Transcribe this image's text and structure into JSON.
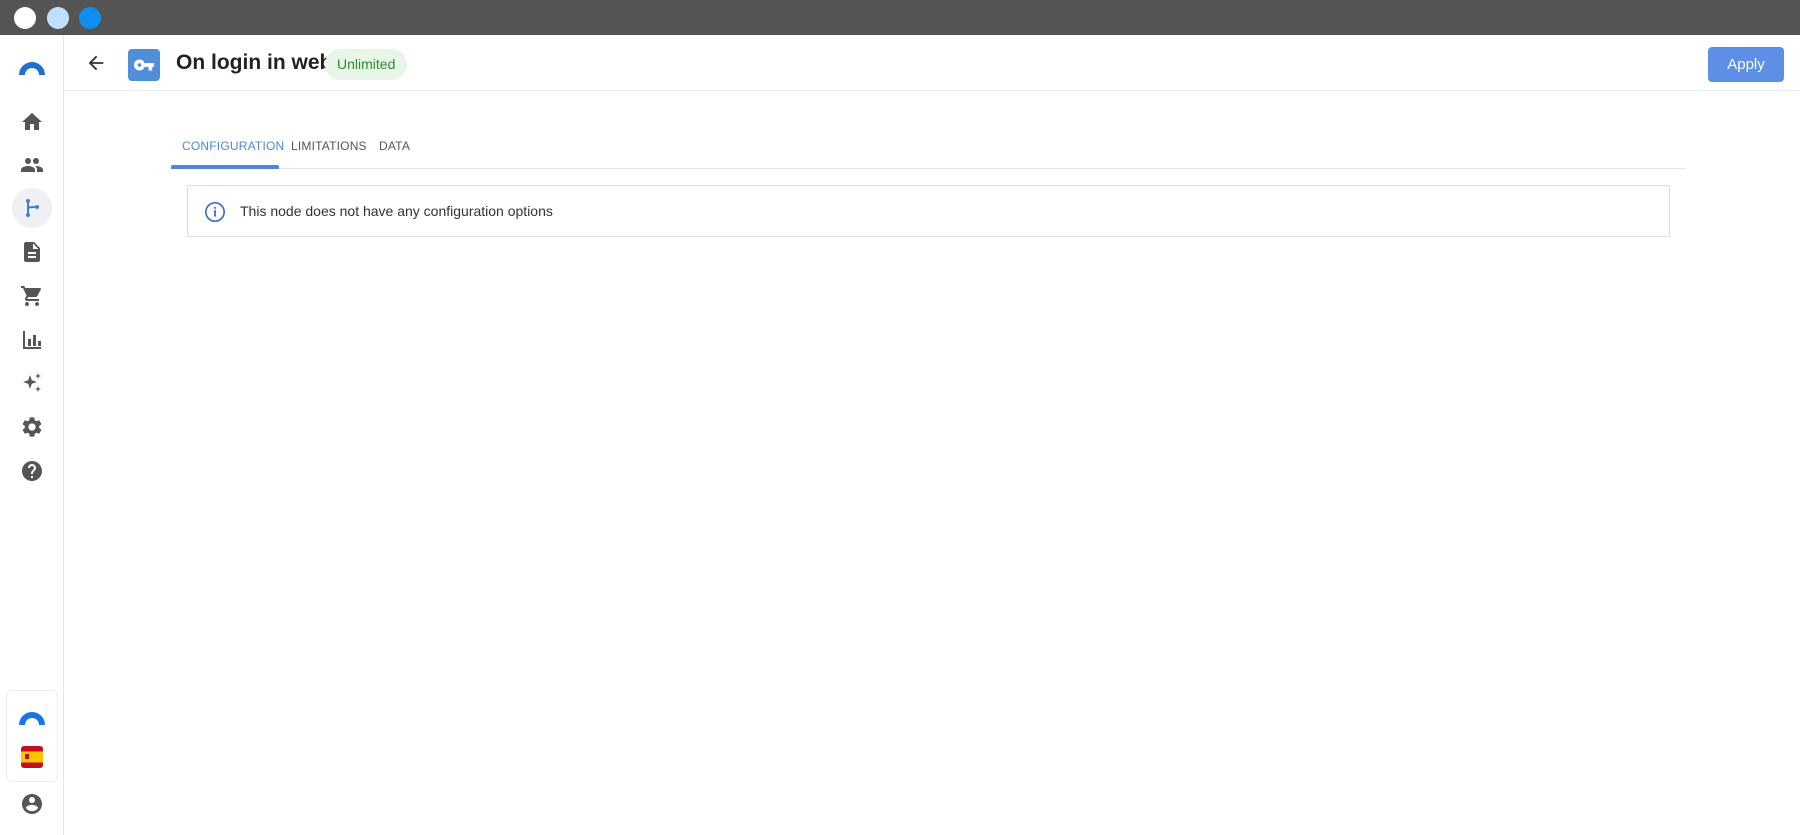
{
  "window": {
    "controls": [
      "close",
      "minimize",
      "maximize"
    ]
  },
  "sidebar": {
    "items": [
      {
        "name": "home",
        "icon": "home-icon"
      },
      {
        "name": "users",
        "icon": "people-icon"
      },
      {
        "name": "flows",
        "icon": "branch-icon",
        "active": true
      },
      {
        "name": "documents",
        "icon": "document-icon"
      },
      {
        "name": "shop",
        "icon": "cart-icon"
      },
      {
        "name": "analytics",
        "icon": "bar-chart-icon"
      },
      {
        "name": "ai",
        "icon": "sparkles-icon"
      },
      {
        "name": "settings",
        "icon": "gear-icon"
      },
      {
        "name": "help",
        "icon": "help-icon"
      }
    ],
    "bottom": {
      "brand_icon": "brand-logo-icon",
      "language_icon": "spain-flag-icon",
      "account_icon": "account-circle-icon"
    }
  },
  "header": {
    "title": "On login in web",
    "badge": "Unlimited",
    "apply_label": "Apply",
    "node_icon": "key-icon"
  },
  "tabs": [
    {
      "label": "CONFIGURATION",
      "active": true
    },
    {
      "label": "LIMITATIONS",
      "active": false
    },
    {
      "label": "DATA",
      "active": false
    }
  ],
  "info": {
    "message": "This node does not have any configuration options",
    "icon": "info-icon"
  },
  "colors": {
    "accent": "#4f86d9",
    "apply_button": "#5d8fe6",
    "badge_bg": "#e7f6e7",
    "badge_text": "#2e8b2e",
    "titlebar": "#545454"
  }
}
